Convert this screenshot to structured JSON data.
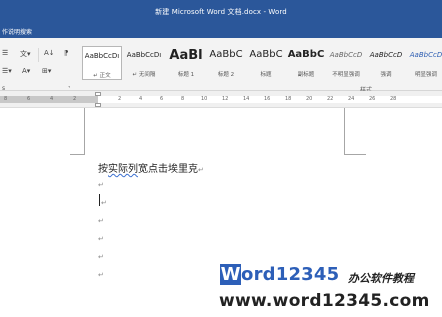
{
  "window": {
    "title": "新建 Microsoft Word 文档.docx - Word"
  },
  "tellme": {
    "label": "作说明搜索"
  },
  "ribbon": {
    "paragraph_controls": [
      "☰",
      "文▾",
      "A↓",
      "⁋",
      "☰▾",
      "A▾",
      "⊞▾"
    ],
    "group_label_left": "s",
    "styles_group_label": "样式",
    "styles": [
      {
        "sample": "AaBbCcDı",
        "name": "↵ 正文",
        "selected": true
      },
      {
        "sample": "AaBbCcDı",
        "name": "↵ 无间隔",
        "selected": false
      },
      {
        "sample": "AaBl",
        "name": "标题 1",
        "selected": false
      },
      {
        "sample": "AaBbC",
        "name": "标题 2",
        "selected": false
      },
      {
        "sample": "AaBbC",
        "name": "标题",
        "selected": false
      },
      {
        "sample": "AaBbC",
        "name": "副标题",
        "selected": false
      },
      {
        "sample": "AaBbCcD",
        "name": "不明显强调",
        "selected": false
      },
      {
        "sample": "AaBbCcD",
        "name": "强调",
        "selected": false
      },
      {
        "sample": "AaBbCcD",
        "name": "明显强调",
        "selected": false
      }
    ]
  },
  "ruler": {
    "ticks": [
      "8",
      "6",
      "4",
      "2",
      "",
      "2",
      "4",
      "6",
      "8",
      "10",
      "12",
      "14",
      "16",
      "18",
      "20",
      "22",
      "24",
      "26",
      "28"
    ]
  },
  "document": {
    "lines": [
      {
        "prefix": "按",
        "spell": "实际列",
        "suffix": "宽点击埃里克",
        "mark": "↵"
      },
      {
        "prefix": "",
        "spell": "",
        "suffix": "",
        "mark": "↵"
      },
      {
        "prefix": "",
        "spell": "",
        "suffix": "",
        "mark": "↵"
      },
      {
        "prefix": "",
        "spell": "",
        "suffix": "",
        "mark": "↵"
      },
      {
        "prefix": "",
        "spell": "",
        "suffix": "",
        "mark": "↵"
      },
      {
        "prefix": "",
        "spell": "",
        "suffix": "",
        "mark": "↵"
      },
      {
        "prefix": "",
        "spell": "",
        "suffix": "",
        "mark": "↵"
      }
    ]
  },
  "watermark": {
    "logo_w": "W",
    "logo_rest": "ord12345",
    "tagline": "办公软件教程",
    "url": "www.word12345.com"
  }
}
